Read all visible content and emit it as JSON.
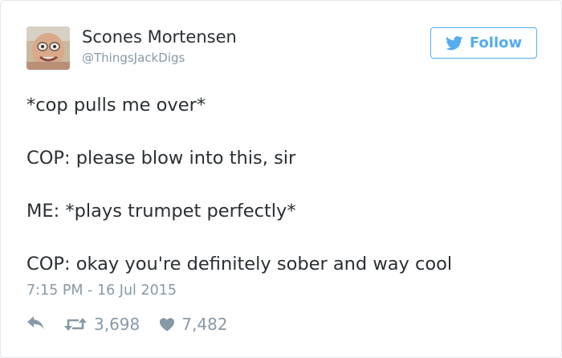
{
  "user": {
    "display_name": "Scones Mortensen",
    "handle": "@ThingsJackDigs"
  },
  "follow_button": {
    "label": "Follow",
    "icon": "twitter-bird-icon",
    "color": "#55acee"
  },
  "tweet": {
    "lines": [
      "*cop pulls me over*",
      "COP: please blow into this, sir",
      "ME: *plays trumpet perfectly*",
      "COP: okay you're definitely sober and way cool"
    ],
    "timestamp": "7:15 PM - 16 Jul 2015"
  },
  "actions": {
    "reply_icon": "reply-icon",
    "retweet_icon": "retweet-icon",
    "retweet_count": "3,698",
    "like_icon": "heart-icon",
    "like_count": "7,482"
  },
  "colors": {
    "text": "#292f33",
    "muted": "#8899a6",
    "accent": "#55acee",
    "border": "#e1e8ed"
  }
}
